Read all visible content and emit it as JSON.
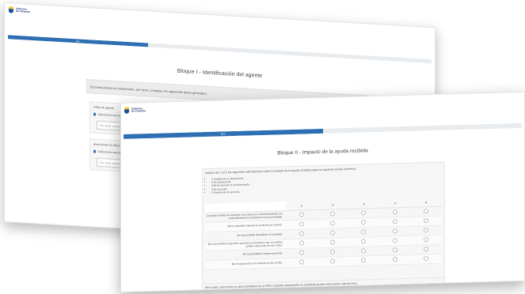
{
  "brand": {
    "name": "Gobierno\nde Canarias"
  },
  "back_window": {
    "progress_label": "0%",
    "progress_fraction": 0.33,
    "block_title": "Bloque I - Identificación del agente",
    "intro_text": "De forma previa al cuestionario, por favor, complete los siguientes datos generales:",
    "questions": [
      {
        "label": "Tipo de agente",
        "option_label": "Seleccione una opción",
        "input_placeholder": "Por favor escriba aquí"
      },
      {
        "label": "Isla donde se ubica",
        "option_label": "Seleccione una opción",
        "input_placeholder": "Por favor escriba aquí"
      }
    ]
  },
  "front_window": {
    "progress_label": "50%",
    "progress_fraction": 0.5,
    "block_title": "Bloque II - Impacto de la ayuda recibida",
    "question_text": "Valore del 1 al 5 las siguientes afirmaciones sobre el impacto de la ayuda recibida según la siguiente escala numérica:",
    "scale": [
      "1-Totalmente en desacuerdo.",
      "2-En desacuerdo.",
      "3-Ni de acuerdo ni en desacuerdo.",
      "4-De acuerdo.",
      "5-Totalmente de acuerdo."
    ],
    "columns": [
      "1",
      "2",
      "3",
      "4",
      "5"
    ],
    "rows": [
      "La ayuda recibida ha supuesto una mejora en el funcionamiento y la competitividad de la institución en la que trabajo.",
      "Me ha permitido mejorar mi producto y/o servicio.",
      "Me ha permitido diversificar mi actividad.",
      "Me ha permitido emprender proyectos innovadores que no hubiera podido emprender de otro modo.",
      "Me ha permitido contratar personal.",
      "Me ha supuesto un incremento de las ventas."
    ],
    "next_question_text": "Por favor, seleccione en qué prioridades de la RIS3 Canarias desempeña su actividad (puede seleccionar más de una)."
  }
}
